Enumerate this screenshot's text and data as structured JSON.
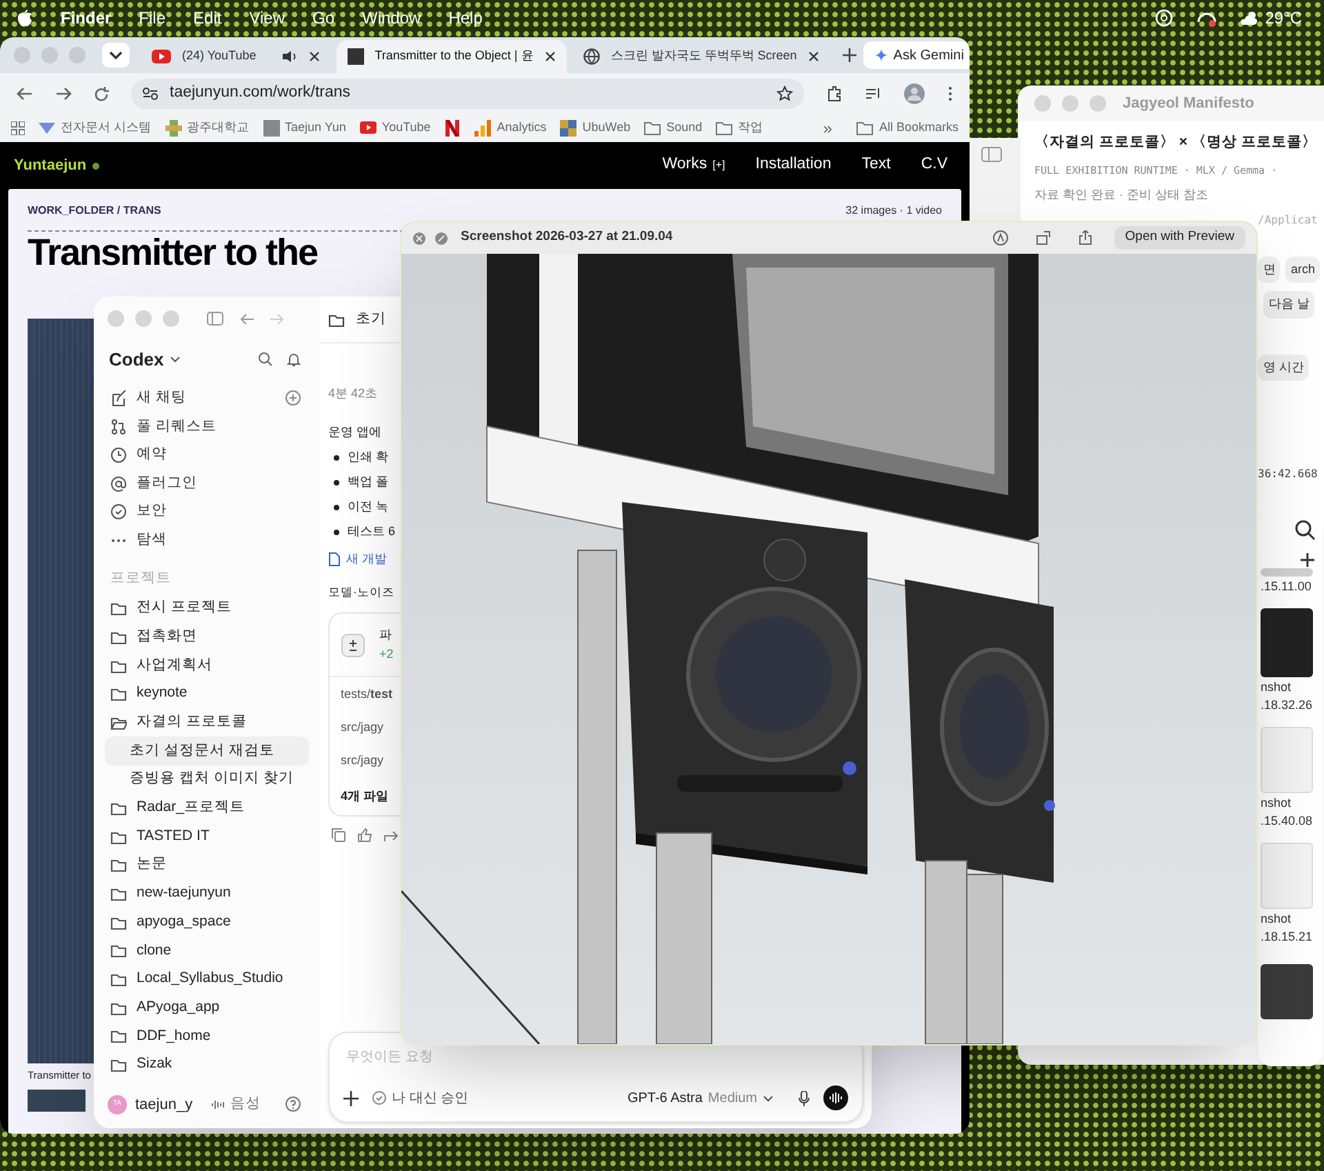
{
  "menu_bar": {
    "app": "Finder",
    "menus": [
      "File",
      "Edit",
      "View",
      "Go",
      "Window",
      "Help"
    ],
    "weather": "29°C"
  },
  "browser": {
    "tabs": [
      {
        "title": "(24) YouTube",
        "kind": "video",
        "playing": true,
        "selected": false
      },
      {
        "title": "Transmitter to the Object | 윤",
        "kind": "site",
        "playing": false,
        "selected": true
      },
      {
        "title": "스크린 발자국도 뚜벅뚜벅 Screen",
        "kind": "globe",
        "playing": false,
        "selected": false
      }
    ],
    "gemini": "Ask Gemini",
    "url": "taejunyun.com/work/trans",
    "bookmarks": [
      {
        "label": "전자문서 시스템",
        "kind": "doc"
      },
      {
        "label": "광주대학교",
        "kind": "campus"
      },
      {
        "label": "Taejun Yun",
        "kind": "photo"
      },
      {
        "label": "YouTube",
        "kind": "video"
      },
      {
        "kind": "letter"
      },
      {
        "label": "Analytics",
        "kind": "bars"
      },
      {
        "label": "UbuWeb",
        "kind": "tiles"
      },
      {
        "label": "Sound",
        "kind": "folder"
      },
      {
        "label": "작업",
        "kind": "folder"
      }
    ],
    "more": "»",
    "all_bookmarks": "All Bookmarks"
  },
  "site": {
    "brand": "Yuntaejun",
    "nav": [
      {
        "label": "Works",
        "suffix": "[+]"
      },
      {
        "label": "Installation"
      },
      {
        "label": "Text"
      },
      {
        "label": "C.V"
      }
    ],
    "breadcrumb": "WORK_FOLDER / TRANS",
    "count": "32 images · 1 video",
    "title_lines": [
      "Transmitter to the"
    ],
    "caption": "Transmitter to"
  },
  "codex": {
    "title": "Codex",
    "nav": [
      {
        "label": "새 채팅",
        "kind": "compose"
      },
      {
        "label": "풀 리퀘스트",
        "kind": "merge"
      },
      {
        "label": "예약",
        "kind": "clock"
      },
      {
        "label": "플러그인",
        "kind": "at"
      },
      {
        "label": "보안",
        "kind": "shield"
      },
      {
        "label": "탐색",
        "kind": "dots"
      }
    ],
    "section": "프로젝트",
    "projects": [
      {
        "name": "전시 프로젝트",
        "expanded": false
      },
      {
        "name": "접촉화면",
        "expanded": false
      },
      {
        "name": "사업계획서",
        "expanded": false
      },
      {
        "name": "keynote",
        "expanded": false
      },
      {
        "name": "자결의 프로토콜",
        "expanded": true,
        "children": [
          {
            "name": "초기 설정문서 재검토",
            "selected": true
          },
          {
            "name": "증빙용 캡처 이미지 찾기",
            "selected": false
          }
        ]
      },
      {
        "name": "Radar_프로젝트",
        "expanded": false
      },
      {
        "name": "TASTED IT",
        "expanded": false
      },
      {
        "name": "논문",
        "expanded": false
      },
      {
        "name": "new-taejunyun",
        "expanded": false
      },
      {
        "name": "apyoga_space",
        "expanded": false
      },
      {
        "name": "clone",
        "expanded": false
      },
      {
        "name": "Local_Syllabus_Studio",
        "expanded": false
      },
      {
        "name": "APyoga_app",
        "expanded": false
      },
      {
        "name": "DDF_home",
        "expanded": false
      },
      {
        "name": "Sizak",
        "expanded": false
      }
    ],
    "user": {
      "initials": "TA",
      "name": "taejun_y"
    },
    "voice": "음성",
    "main": {
      "header": "초기",
      "elapsed": "4분 42초",
      "intro": "운영 앱에",
      "bullets": [
        "인쇄 확",
        "백업 폴",
        "이전 녹",
        "테스트 6"
      ],
      "link": "새 개발",
      "heading": "모델·노이즈",
      "card": {
        "title": "파",
        "delta": "+2",
        "files": [
          "tests/**test**",
          "src/jagy",
          "src/jagy"
        ],
        "more": "4개 파일"
      },
      "composer": {
        "placeholder": "무엇이든 요청",
        "approval": "나 대신 승인",
        "model": "GPT-6 Astra",
        "effort": "Medium"
      }
    }
  },
  "preview": {
    "title": "Screenshot 2026-03-27 at 21.09.04",
    "open_button": "Open with Preview"
  },
  "manifesto": {
    "title": "Jagyeol Manifesto",
    "heading": "〈자결의 프로토콜〉 × 〈명상 프로토콜〉",
    "subtitle": "FULL EXHIBITION RUNTIME · MLX / Gemma ·",
    "status": "자료 확인 완료 · 준비 상태 참조",
    "path": "/Applicat",
    "chip_rows": [
      [
        "면",
        "arch"
      ],
      [
        "다음 날"
      ],
      [
        "영 시간"
      ]
    ],
    "timestamp": "36:42.668"
  },
  "thumbnails": [
    {
      "kind": "gray",
      "lines": [
        ".15.11.00"
      ]
    },
    {
      "kind": "dark",
      "lines": [
        "nshot",
        ".18.32.26"
      ]
    },
    {
      "kind": "light",
      "lines": [
        "nshot",
        ".15.40.08"
      ]
    },
    {
      "kind": "light",
      "lines": [
        "nshot",
        ".18.15.21"
      ]
    },
    {
      "kind": "photo"
    }
  ]
}
